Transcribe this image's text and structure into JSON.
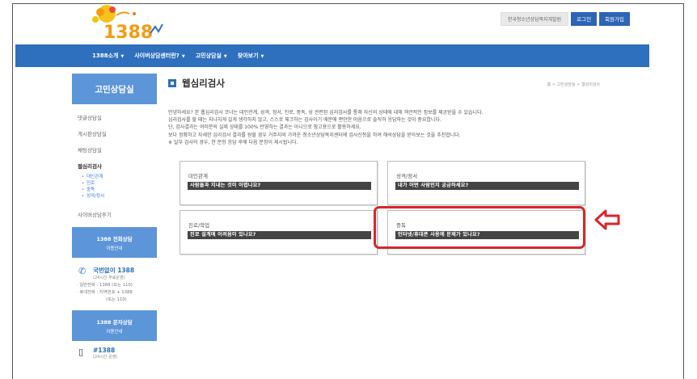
{
  "header": {
    "logo_text": "1388",
    "org_link": "한국청소년상담복지개발원",
    "login": "로그인",
    "signup": "회원가입"
  },
  "nav": {
    "items": [
      {
        "label": "1388소개"
      },
      {
        "label": "사이버상담센터란?"
      },
      {
        "label": "고민상담실"
      },
      {
        "label": "찾아보기"
      }
    ]
  },
  "sidebar": {
    "title": "고민상담실",
    "links": [
      "댓글상담실",
      "게시판상담실",
      "채팅상담실",
      "웹심리검사"
    ],
    "sub_items": [
      "대인관계",
      "진로",
      "중독",
      "성격/정서"
    ],
    "after_link": "사이버상담후기",
    "phone_box": {
      "title": "1388 전화상담",
      "sub": "이용안내"
    },
    "phone": {
      "name": "국번없이 1388",
      "hours": "(24시간 무료운영)",
      "general": "· 일반전화 : 1388 (또는 110)",
      "mobile": "· 휴대전화 : 지역번호 + 1388",
      "mobile2": "(또는 110)"
    },
    "sms_box": {
      "title": "1388 문자상담",
      "sub": "이용안내"
    },
    "sms": {
      "name": "#1388",
      "hours": "(24시간 운영)"
    }
  },
  "main": {
    "title": "웹심리검사",
    "breadcrumb": "홈 > 고민상담실 > 웹심리검사",
    "intro": [
      "안녕하세요? 본 웹심리검사 코너는 대인관계, 성격, 정서, 진로, 중독, 성 관련된 심리검사를 통해 자신의 상태에 대해 객관적인 정보를 제공받을 수 있습니다.",
      "심리검사를 할 때는 지나치게 길게 생각하지 않고, 스스로 체크하는 검사이기 때문에 편안한 마음으로 솔직히 응답하는 것이 중요합니다.",
      "단, 검사결과는 여러분의 실제 상태를 100% 반영하는 결과는 아니므로 참고용으로 활용하세요.",
      "보다 정확하고 자세한 심리검사 결과를 원할 경우 거주지와 가까운 청소년상담복지센터에 검사신청을 하여 해석상담을 받아보는 것을 추천합니다.",
      "※ 일부 검사의 경우, 한 문항 응답 후에 다음 문항이 제시됩니다."
    ],
    "cards": [
      {
        "category": "대인관계",
        "question": "사람들과 지내는 것이 어렵나요?"
      },
      {
        "category": "성격/정서",
        "question": "내가 어떤 사람인지 궁금하세요?"
      },
      {
        "category": "진로/학업",
        "question": "진로 설계에 어려움이 있나요?"
      },
      {
        "category": "중독",
        "question": "인터넷/휴대폰 사용에 문제가 있나요?"
      }
    ]
  },
  "colors": {
    "nav": "#2e6fbe",
    "sidebar_box": "#5d95d9",
    "highlight": "#d9262c"
  }
}
